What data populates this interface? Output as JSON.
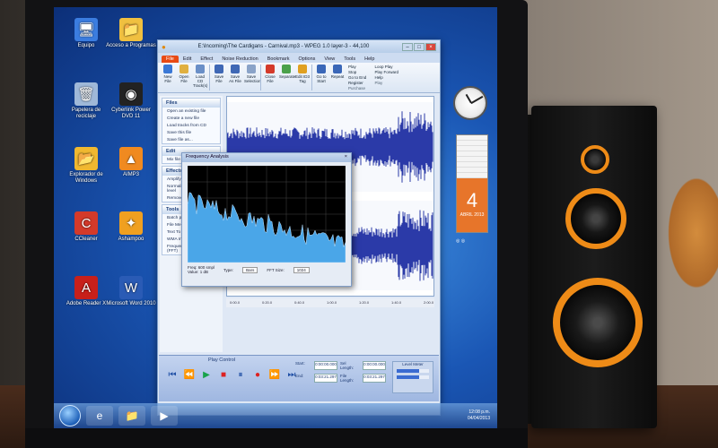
{
  "desktop": {
    "icons": [
      {
        "label": "Equipo",
        "glyph": "🖥"
      },
      {
        "label": "Acceso a Programas",
        "glyph": "📁"
      },
      {
        "label": "Papelera de reciclaje",
        "glyph": "🗑"
      },
      {
        "label": "Cyberlink Power DVD 11",
        "glyph": "◉"
      },
      {
        "label": "Explorador de Windows",
        "glyph": "📂"
      },
      {
        "label": "AIMP3",
        "glyph": "▲"
      },
      {
        "label": "CCleaner",
        "glyph": "C"
      },
      {
        "label": "Ashampoo",
        "glyph": "✦"
      },
      {
        "label": "Adobe Reader X",
        "glyph": "A"
      },
      {
        "label": "Microsoft Word 2010",
        "glyph": "W"
      }
    ]
  },
  "app": {
    "title": "E:\\Incoming\\The Cardigans - Carnival.mp3 - WPEG 1.0 layer-3 - 44,100",
    "tabs": [
      "File",
      "Edit",
      "Effect",
      "Noise Reduction",
      "Bookmark",
      "Options",
      "View",
      "Tools",
      "Help"
    ],
    "active_tab": "File",
    "ribbon": [
      {
        "label": "New File",
        "color": "#3a78d6"
      },
      {
        "label": "Open File",
        "color": "#e0b040"
      },
      {
        "label": "Load CD Track(s)",
        "color": "#6a8fc7"
      },
      {
        "label": "Save File",
        "color": "#3f68b5"
      },
      {
        "label": "Save As File",
        "color": "#3f68b5"
      },
      {
        "label": "Save Selection",
        "color": "#8aa3c8"
      },
      {
        "label": "Close File",
        "color": "#d43a2a"
      },
      {
        "label": "Separate",
        "color": "#4aa14a"
      },
      {
        "label": "Edit ID3 Tag",
        "color": "#e0a020"
      },
      {
        "label": "Go to Start",
        "color": "#3a67b8"
      },
      {
        "label": "Repeat",
        "color": "#3a67b8"
      }
    ],
    "ribbon_right": [
      "Play",
      "Loop Play",
      "Stop",
      "Play Forward",
      "Go to End",
      "Help",
      "Register"
    ],
    "ribbon_groups": [
      "Play",
      "Purchase"
    ],
    "tasks": {
      "files": {
        "title": "Files",
        "items": [
          "Open an existing file",
          "Create a new file",
          "Load tracks from CD",
          "Save this file",
          "Save file as..."
        ]
      },
      "edit": {
        "title": "Edit",
        "items": [
          "Mix file with selection"
        ]
      },
      "effects": {
        "title": "Effects",
        "items": [
          "Amplify louder or softer",
          "Normalize to optimal level",
          "Remove noise or hiss"
        ]
      },
      "tools": {
        "title": "Tools",
        "items": [
          "Batch processor",
          "File Merger",
          "Text To Speech",
          "WMA Information",
          "Frequency Analysis (FFT)"
        ]
      }
    },
    "timeline": [
      "0:00.0",
      "0:20.0",
      "0:40.0",
      "1:00.0",
      "1:20.0",
      "1:40.0",
      "2:00.0"
    ],
    "freq_dialog": {
      "title": "Frequency Analysis",
      "freq_label": "Freq:",
      "freq_value": "600 smpl",
      "value_label": "Value:",
      "value_value": "1 dB",
      "type_label": "Type:",
      "type_value": "Bars",
      "fft_label": "FFT Size:",
      "fft_value": "1024"
    },
    "play_control": {
      "title": "Play Control",
      "start_label": "Start:",
      "start_value": "0:00:00.000",
      "end_label": "End:",
      "end_value": "0:03:21.297",
      "sel_length_label": "Sel Length:",
      "sel_length_value": "0:00:00.000",
      "file_length_label": "File Length:",
      "file_length_value": "0:03:21.297",
      "level_label": "Level Meter"
    }
  },
  "gadgets": {
    "calendar_day": "4",
    "calendar_sub": "ABRIL 2013"
  },
  "taskbar": {
    "time": "12:08 p.m.",
    "date": "04/04/2013"
  },
  "colors": {
    "accent_tab": "#e84a14",
    "speaker_ring": "#ee8b17",
    "desktop": "#1a56b4"
  }
}
